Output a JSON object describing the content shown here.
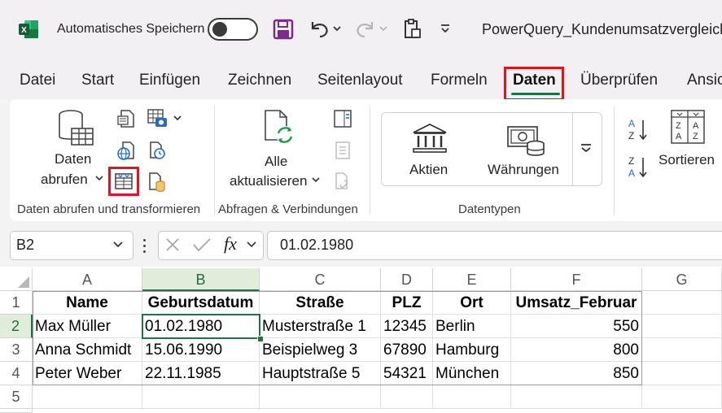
{
  "titlebar": {
    "autosave_label": "Automatisches Speichern",
    "filename": "PowerQuery_Kundenumsatzvergleich."
  },
  "tabs": [
    "Datei",
    "Start",
    "Einfügen",
    "Zeichnen",
    "Seitenlayout",
    "Formeln",
    "Daten",
    "Überprüfen",
    "Ansic"
  ],
  "active_tab": "Daten",
  "ribbon": {
    "daten_abrufen_line1": "Daten",
    "daten_abrufen_line2": "abrufen",
    "group1_label": "Daten abrufen und transformieren",
    "alle_line1": "Alle",
    "alle_line2": "aktualisieren",
    "group2_label": "Abfragen & Verbindungen",
    "aktien_label": "Aktien",
    "waehrungen_label": "Währungen",
    "group3_label": "Datentypen",
    "sortieren_label": "Sortieren"
  },
  "formula_bar": {
    "name_box": "B2",
    "fx": "fx",
    "value": "01.02.1980"
  },
  "sheet": {
    "columns": [
      "A",
      "B",
      "C",
      "D",
      "E",
      "F",
      "G"
    ],
    "rows": [
      "1",
      "2",
      "3",
      "4",
      "5"
    ],
    "header": [
      "Name",
      "Geburtsdatum",
      "Straße",
      "PLZ",
      "Ort",
      "Umsatz_Februar"
    ],
    "data": [
      [
        "Max Müller",
        "01.02.1980",
        "Musterstraße 1",
        "12345",
        "Berlin",
        "550"
      ],
      [
        "Anna Schmidt",
        "15.06.1990",
        "Beispielweg 3",
        "67890",
        "Hamburg",
        "800"
      ],
      [
        "Peter Weber",
        "22.11.1985",
        "Hauptstraße 5",
        "54321",
        "München",
        "850"
      ]
    ],
    "selected_cell": "B2"
  },
  "colors": {
    "excel_green": "#217346",
    "highlight_red": "#e0141e",
    "active_tab_underline": "#1e7145"
  }
}
